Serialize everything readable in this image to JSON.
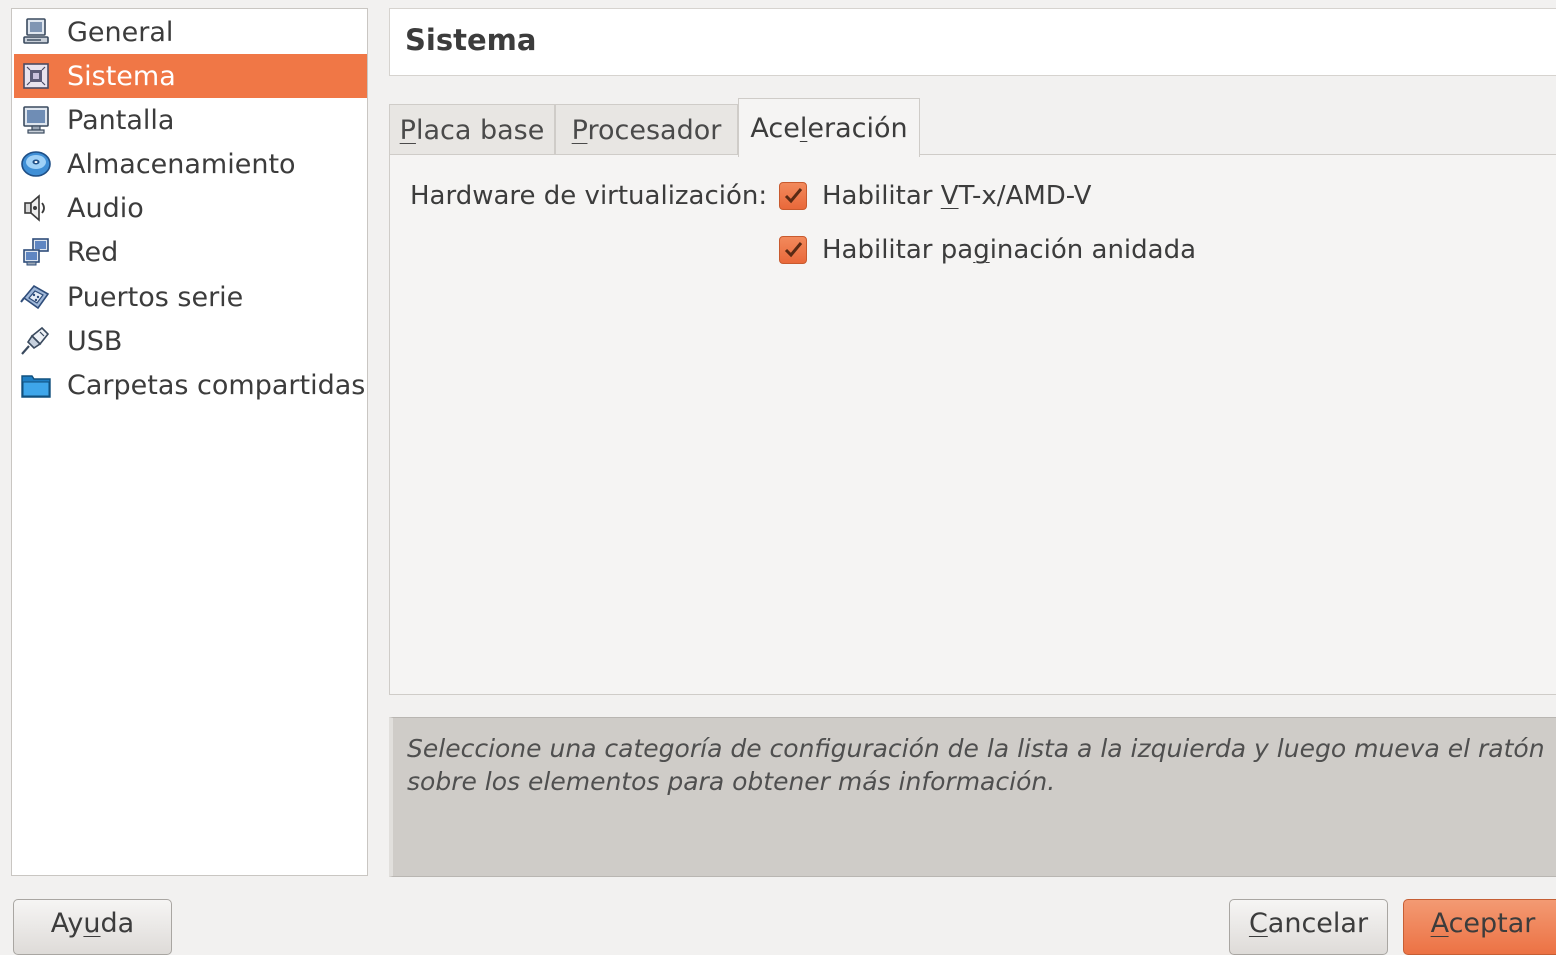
{
  "sidebar": {
    "items": [
      {
        "label": "General",
        "icon": "monitor-icon",
        "selected": false
      },
      {
        "label": "Sistema",
        "icon": "chip-icon",
        "selected": true
      },
      {
        "label": "Pantalla",
        "icon": "display-icon",
        "selected": false
      },
      {
        "label": "Almacenamiento",
        "icon": "disc-icon",
        "selected": false
      },
      {
        "label": "Audio",
        "icon": "speaker-icon",
        "selected": false
      },
      {
        "label": "Red",
        "icon": "network-icon",
        "selected": false
      },
      {
        "label": "Puertos serie",
        "icon": "serial-port-icon",
        "selected": false
      },
      {
        "label": "USB",
        "icon": "usb-icon",
        "selected": false
      },
      {
        "label": "Carpetas compartidas",
        "icon": "folder-icon",
        "selected": false
      }
    ]
  },
  "header": {
    "title": "Sistema"
  },
  "tabs": [
    {
      "label": "Placa base",
      "mnemonic_first": "P",
      "rest": "laca base",
      "active": false
    },
    {
      "label": "Procesador",
      "mnemonic_first": "P",
      "rest": "rocesador",
      "active": false
    },
    {
      "label": "Aceleración",
      "pre": "Ace",
      "mnemonic": "l",
      "post": "eración",
      "active": true
    }
  ],
  "acceleration": {
    "hardware_label": "Hardware de virtualización:",
    "options": [
      {
        "pre": "Habilitar ",
        "mnemonic": "V",
        "post": "T-x/AMD-V",
        "checked": true
      },
      {
        "pre": "Habilitar pa",
        "mnemonic": "g",
        "post": "inación anidada",
        "checked": true
      }
    ]
  },
  "info": {
    "text": "Seleccione una categoría de configuración de la lista a la izquierda y luego mueva el ratón sobre los elementos para obtener más información."
  },
  "buttons": {
    "help": {
      "pre": "Ay",
      "mnemonic": "u",
      "post": "da"
    },
    "cancel": {
      "mnemonic": "C",
      "post": "ancelar"
    },
    "accept": {
      "mnemonic": "A",
      "post": "ceptar"
    }
  },
  "colors": {
    "accent": "#f07746",
    "checkbox": "#ec7244",
    "window_bg": "#f2f1f0",
    "info_bg": "#cfccc8"
  }
}
